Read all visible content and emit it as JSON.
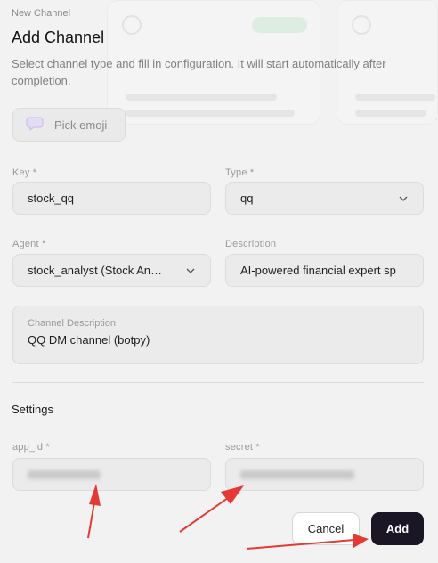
{
  "modal": {
    "eyebrow": "New Channel",
    "title": "Add Channel",
    "subtitle": "Select channel type and fill in configuration. It will start automatically after completion.",
    "emoji_button": {
      "label": "Pick emoji",
      "icon": "speech-bubble-icon"
    }
  },
  "form": {
    "key": {
      "label": "Key *",
      "value": "stock_qq"
    },
    "type": {
      "label": "Type *",
      "value": "qq",
      "icon": "chevron-down-icon"
    },
    "agent": {
      "label": "Agent *",
      "value": "stock_analyst (Stock An…",
      "icon": "chevron-down-icon"
    },
    "description": {
      "label": "Description",
      "value": "AI-powered financial expert sp"
    },
    "channel_description": {
      "label": "Channel Description",
      "value": "QQ DM channel (botpy)"
    }
  },
  "settings": {
    "title": "Settings",
    "app_id": {
      "label": "app_id *"
    },
    "secret": {
      "label": "secret *"
    }
  },
  "actions": {
    "cancel": "Cancel",
    "add": "Add"
  },
  "colors": {
    "primary_button": "#1b1625",
    "annotation_arrow": "#e53935",
    "background": "#f2f2f2"
  }
}
